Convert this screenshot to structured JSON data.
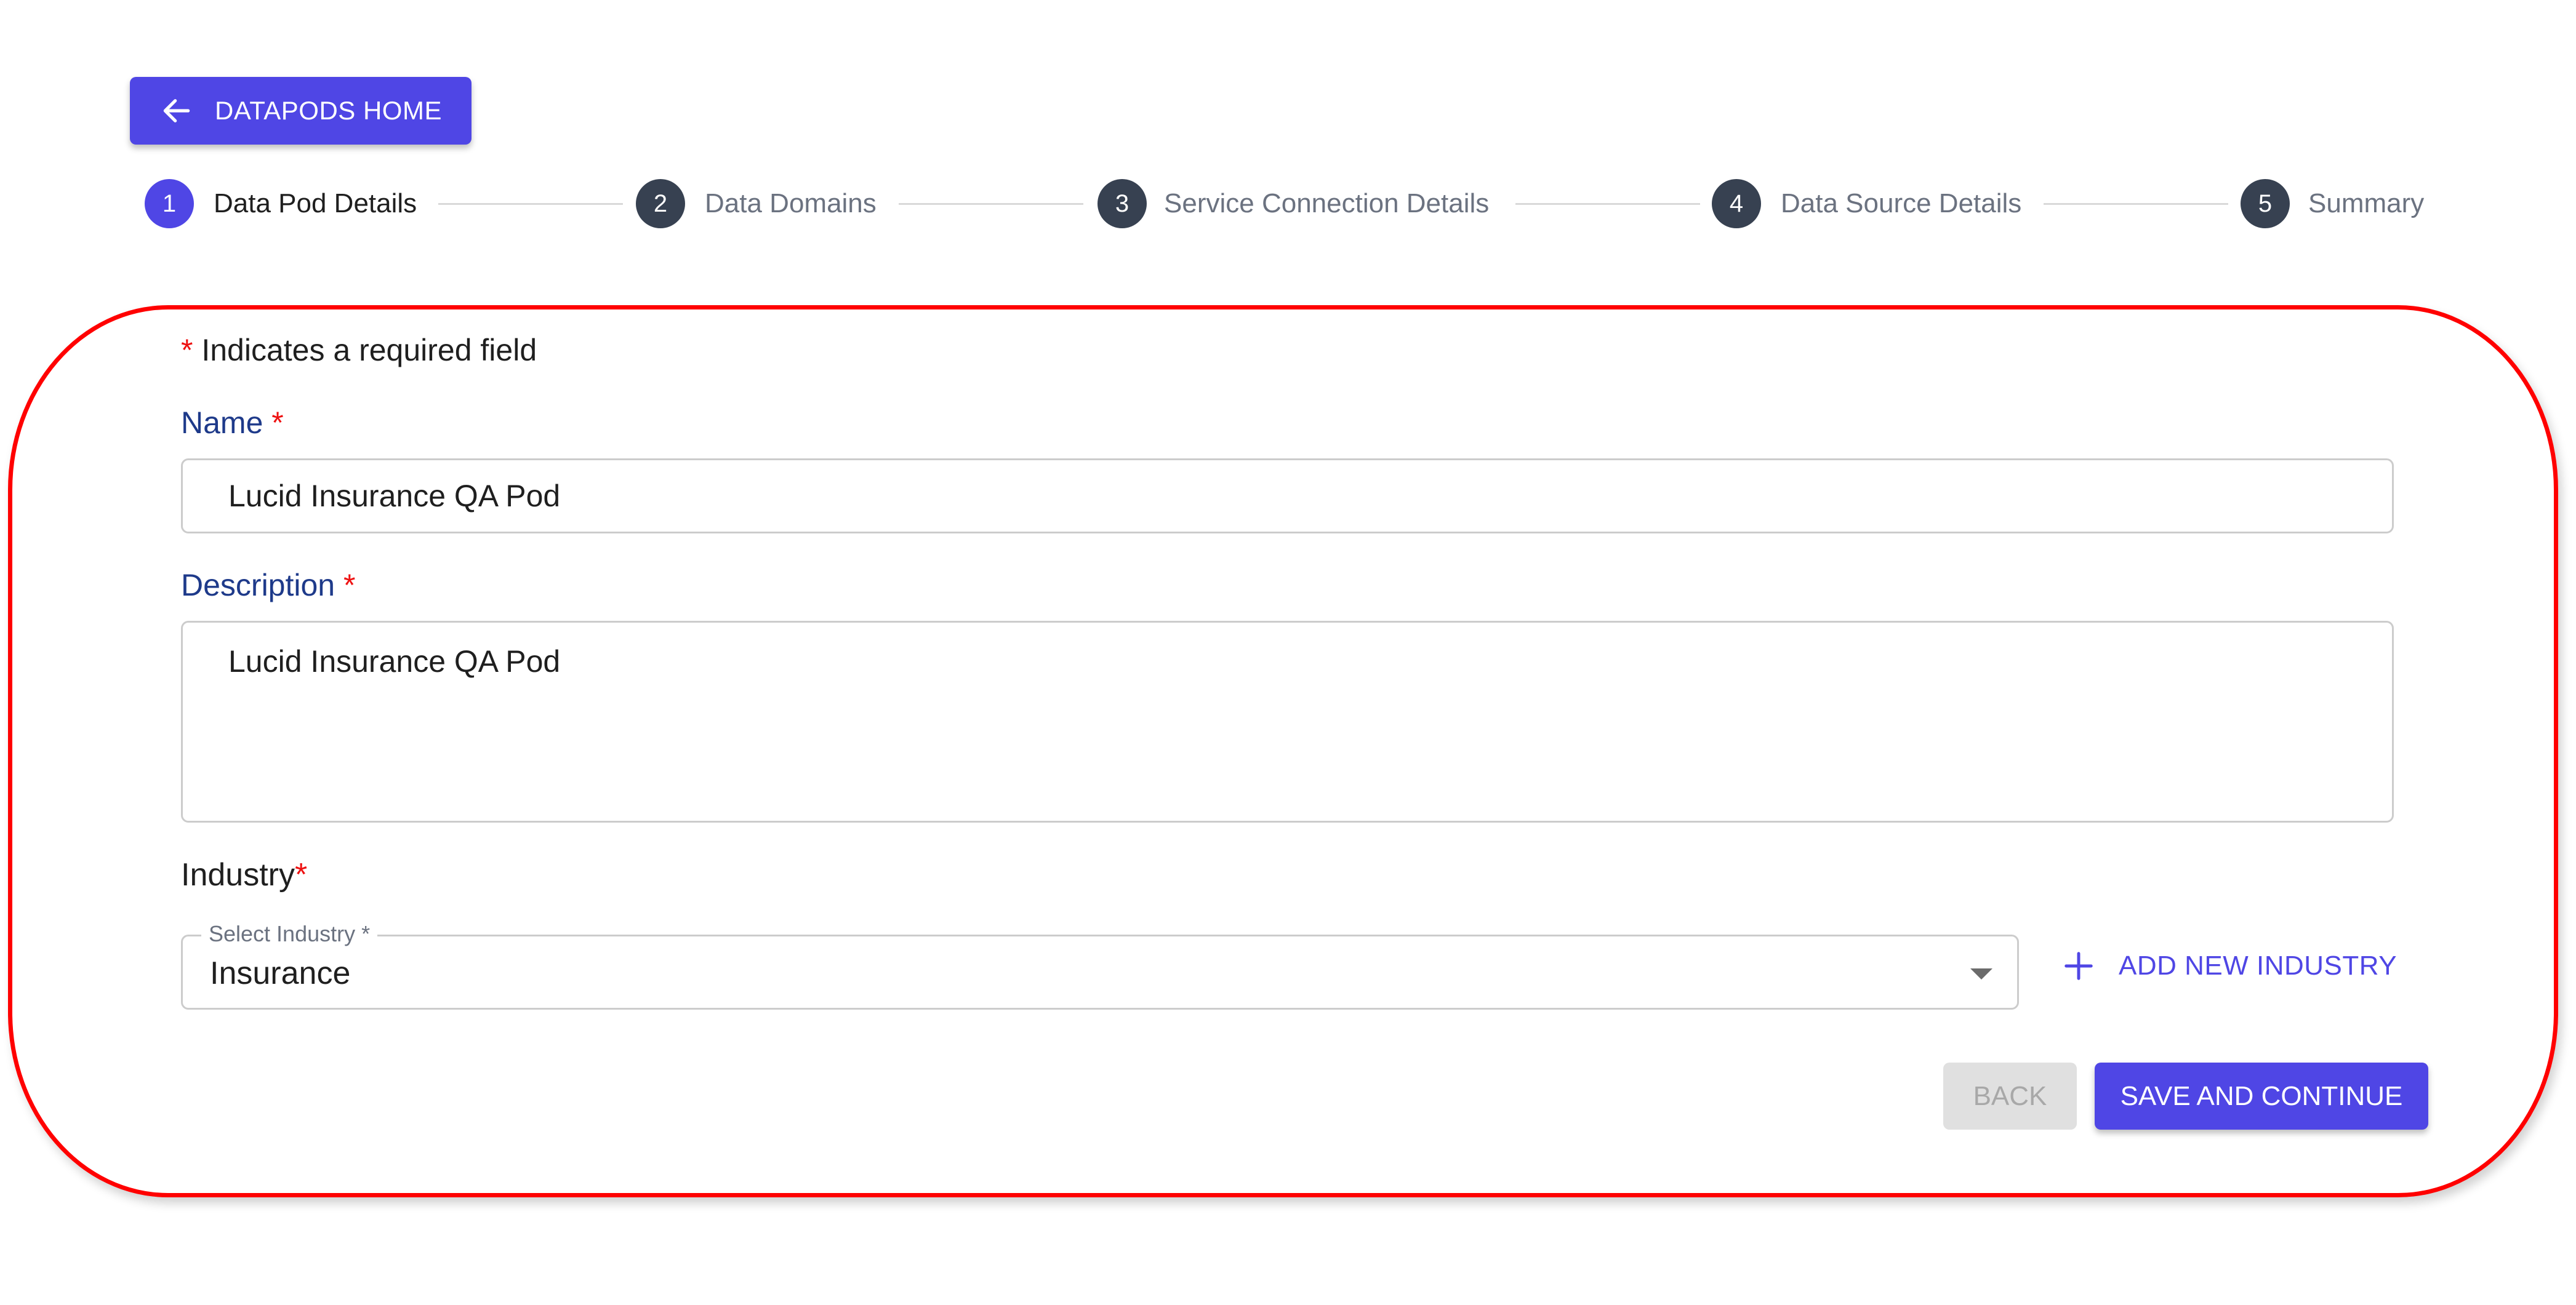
{
  "header": {
    "home_button_label": "DATAPODS HOME",
    "home_button_icon": "arrow-left-icon"
  },
  "stepper": {
    "steps": [
      {
        "number": "1",
        "label": "Data Pod Details",
        "state": "active"
      },
      {
        "number": "2",
        "label": "Data Domains",
        "state": "inactive"
      },
      {
        "number": "3",
        "label": "Service Connection Details",
        "state": "inactive"
      },
      {
        "number": "4",
        "label": "Data Source Details",
        "state": "inactive"
      },
      {
        "number": "5",
        "label": "Summary",
        "state": "inactive"
      }
    ]
  },
  "form": {
    "required_note_star": "*",
    "required_note_text": " Indicates a required field",
    "name": {
      "label": "Name",
      "required_mark": " *",
      "value": "Lucid Insurance QA Pod"
    },
    "description": {
      "label": "Description",
      "required_mark": " *",
      "value": "Lucid Insurance QA Pod"
    },
    "industry": {
      "label": "Industry",
      "required_mark": "*",
      "select_legend": "Select Industry *",
      "selected_value": "Insurance",
      "dropdown_icon": "caret-down-icon"
    },
    "add_industry_label": "ADD NEW INDUSTRY",
    "add_industry_icon": "plus-icon"
  },
  "actions": {
    "back_label": "BACK",
    "back_disabled": true,
    "save_label": "SAVE AND CONTINUE"
  },
  "colors": {
    "primary": "#4f46e5",
    "step_inactive": "#374151",
    "required": "#ee1111",
    "label_navy": "#1e3a8a",
    "highlight_frame": "#ff0000"
  }
}
